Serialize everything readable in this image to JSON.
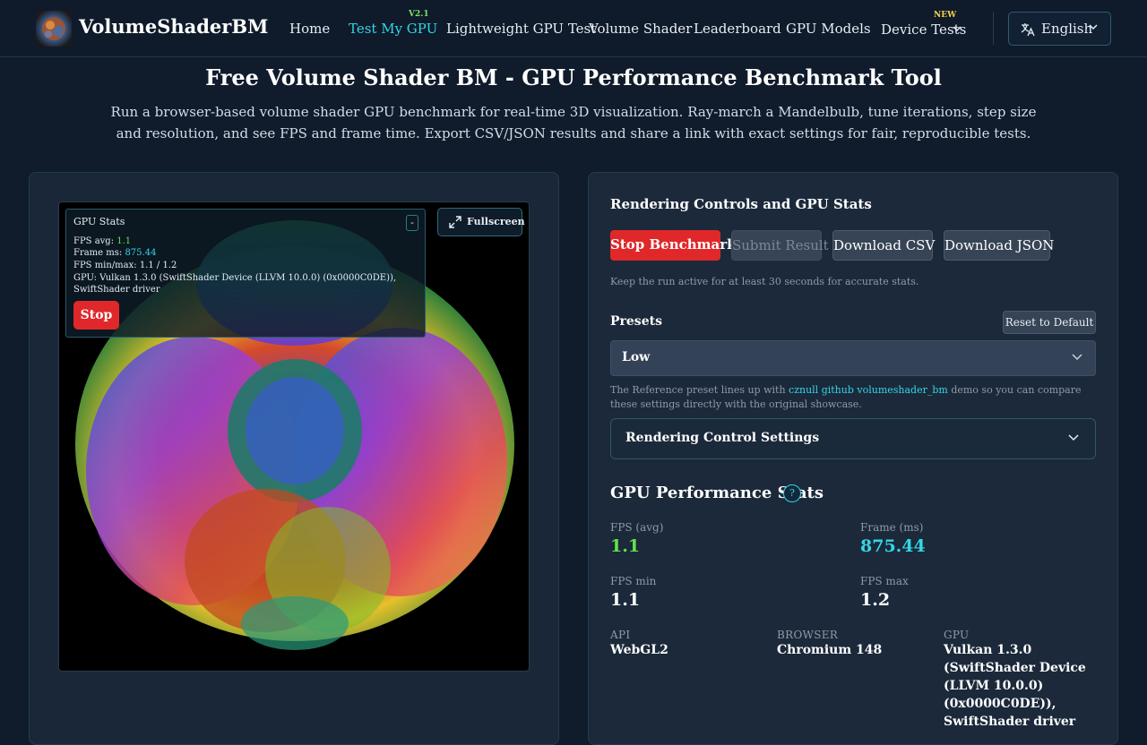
{
  "header": {
    "brand": "VolumeShaderBM",
    "nav": [
      {
        "label": "Home"
      },
      {
        "label": "Test My GPU",
        "badge": "V2.1",
        "active": true
      },
      {
        "label": "Lightweight GPU Test"
      },
      {
        "label": "Volume Shader"
      },
      {
        "label": "Leaderboard"
      },
      {
        "label": "GPU Models"
      },
      {
        "label": "Device Tests",
        "badge": "NEW"
      }
    ],
    "language": "English",
    "icons": [
      "logo-image",
      "chevron-down-icon",
      "translate-icon"
    ]
  },
  "hero": {
    "title": "Free Volume Shader BM - GPU Performance Benchmark Tool",
    "description": "Run a browser-based volume shader GPU benchmark for real-time 3D visualization. Ray-march a Mandelbulb, tune iterations, step size and resolution, and see FPS and frame time. Export CSV/JSON results and share a link with exact settings for fair, reproducible tests."
  },
  "overlay": {
    "title": "GPU Stats",
    "minimize_label": "-",
    "fps_avg_label": "FPS avg:",
    "fps_avg_value": "1.1",
    "frame_ms_label": "Frame ms:",
    "frame_ms_value": "875.44",
    "fps_minmax_text": "FPS min/max: 1.1 / 1.2",
    "gpu_text": "GPU: Vulkan 1.3.0 (SwiftShader Device (LLVM 10.0.0) (0x0000C0DE)), SwiftShader driver",
    "stop_label": "Stop",
    "fullscreen_label": "Fullscreen"
  },
  "controls": {
    "title": "Rendering Controls and GPU Stats",
    "stop_benchmark": "Stop Benchmark",
    "submit_result": "Submit Result",
    "download_csv": "Download CSV",
    "download_json": "Download JSON",
    "hint": "Keep the run active for at least 30 seconds for accurate stats.",
    "presets_label": "Presets",
    "reset_label": "Reset to Default",
    "preset_value": "Low",
    "ref_note_before": "The Reference preset lines up with ",
    "ref_note_link": "cznull github volumeshader_bm",
    "ref_note_after": " demo so you can compare these settings directly with the original showcase.",
    "accordion_label": "Rendering Control Settings"
  },
  "stats": {
    "title": "GPU Performance Stats",
    "help": "?",
    "fps_avg_label": "FPS (avg)",
    "fps_avg": "1.1",
    "frame_label": "Frame (ms)",
    "frame": "875.44",
    "fps_min_label": "FPS min",
    "fps_min": "1.1",
    "fps_max_label": "FPS max",
    "fps_max": "1.2",
    "api_label": "API",
    "api": "WebGL2",
    "browser_label": "BROWSER",
    "browser": "Chromium 148",
    "gpu_label": "GPU",
    "gpu": "Vulkan 1.3.0 (SwiftShader Device (LLVM 10.0.0) (0x0000C0DE)), SwiftShader driver"
  },
  "colors": {
    "accent": "#33d6e6",
    "danger": "#e0282a",
    "good": "#62e34a",
    "background": "#101b2c"
  }
}
